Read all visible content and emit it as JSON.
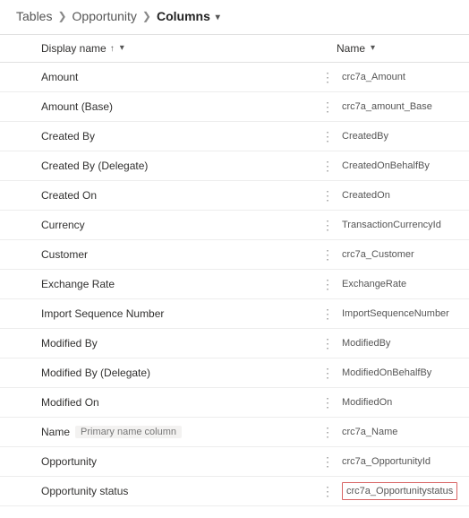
{
  "breadcrumb": {
    "root": "Tables",
    "mid": "Opportunity",
    "current": "Columns"
  },
  "columns": {
    "display_header": "Display name",
    "name_header": "Name"
  },
  "badge_primary": "Primary name column",
  "rows": [
    {
      "display": "Amount",
      "name": "crc7a_Amount"
    },
    {
      "display": "Amount (Base)",
      "name": "crc7a_amount_Base"
    },
    {
      "display": "Created By",
      "name": "CreatedBy"
    },
    {
      "display": "Created By (Delegate)",
      "name": "CreatedOnBehalfBy"
    },
    {
      "display": "Created On",
      "name": "CreatedOn"
    },
    {
      "display": "Currency",
      "name": "TransactionCurrencyId"
    },
    {
      "display": "Customer",
      "name": "crc7a_Customer"
    },
    {
      "display": "Exchange Rate",
      "name": "ExchangeRate"
    },
    {
      "display": "Import Sequence Number",
      "name": "ImportSequenceNumber"
    },
    {
      "display": "Modified By",
      "name": "ModifiedBy"
    },
    {
      "display": "Modified By (Delegate)",
      "name": "ModifiedOnBehalfBy"
    },
    {
      "display": "Modified On",
      "name": "ModifiedOn"
    },
    {
      "display": "Name",
      "name": "crc7a_Name",
      "primary": true
    },
    {
      "display": "Opportunity",
      "name": "crc7a_OpportunityId"
    },
    {
      "display": "Opportunity status",
      "name": "crc7a_Opportunitystatus",
      "highlight": true
    }
  ]
}
